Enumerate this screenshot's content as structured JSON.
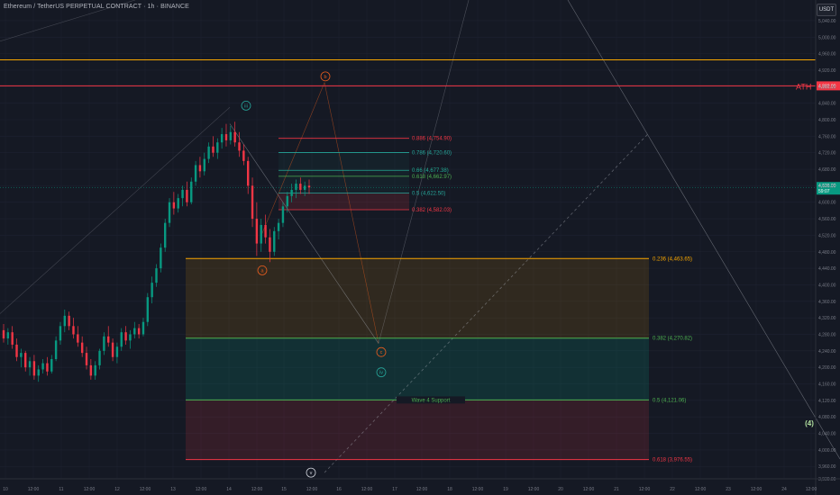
{
  "header": {
    "symbol_title": "Ethereum / TetherUS PERPETUAL CONTRACT · 1h · BINANCE",
    "currency": "USDT"
  },
  "colors": {
    "background": "#151924",
    "grid": "#1f2330",
    "up_candle": "#089981",
    "down_candle": "#f23645",
    "orange_line": "#f7a600",
    "red_line": "#f23645",
    "teal_line": "#22ab94",
    "green_line": "#4caf50",
    "wave_orange": "#e65c1e",
    "wave_teal": "#26a69a",
    "wave_green": "#b2e0a0"
  },
  "chart_data": {
    "type": "candlestick",
    "y_axis": {
      "range": [
        3930,
        5090
      ],
      "ticks": [
        3930,
        3960,
        4000,
        4040,
        4080,
        4120,
        4160,
        4200,
        4240,
        4280,
        4320,
        4360,
        4400,
        4440,
        4480,
        4520,
        4560,
        4600,
        4640,
        4680,
        4720,
        4760,
        4800,
        4840,
        4880,
        4920,
        4960,
        5000,
        5040
      ],
      "tick_labels": [
        "3,930.00",
        "3,960.00",
        "4,000.00",
        "4,040.00",
        "4,080.00",
        "4,120.00",
        "4,160.00",
        "4,200.00",
        "4,240.00",
        "4,280.00",
        "4,320.00",
        "4,360.00",
        "4,400.00",
        "4,440.00",
        "4,480.00",
        "4,520.00",
        "4,560.00",
        "4,600.00",
        "4,640.00",
        "4,680.00",
        "4,720.00",
        "4,760.00",
        "4,800.00",
        "4,840.00",
        "4,880.00",
        "4,920.00",
        "4,960.00",
        "5,000.00",
        "5,040.00"
      ]
    },
    "x_axis": {
      "labels": [
        "10",
        "12:00",
        "11",
        "12:00",
        "12",
        "12:00",
        "13",
        "12:00",
        "14",
        "12:00",
        "15",
        "12:00",
        "16",
        "12:00",
        "17",
        "12:00",
        "18",
        "12:00",
        "19",
        "12:00",
        "20",
        "12:00",
        "21",
        "12:00",
        "22",
        "12:00",
        "23",
        "12:00",
        "24",
        "12:00"
      ]
    },
    "current_price": "4,636.00",
    "countdown": "59:07",
    "horizontal_levels": [
      {
        "label": "ATH",
        "value": 4882,
        "price_tag": "4,882.00",
        "color": "#f23645"
      },
      {
        "label": "",
        "value": 4945,
        "color": "#f7a600"
      }
    ],
    "fib_retracement_small": [
      {
        "label": "0.886 (4,754.90)",
        "value": 4754.9,
        "color": "#f23645"
      },
      {
        "label": "0.786 (4,720.60)",
        "value": 4720.6,
        "color": "#26a69a"
      },
      {
        "label": "0.66 (4,677.38)",
        "value": 4677.38,
        "color": "#22ab94"
      },
      {
        "label": "0.618 (4,662.97)",
        "value": 4662.97,
        "color": "#4caf50"
      },
      {
        "label": "0.5 (4,622.50)",
        "value": 4622.5,
        "color": "#26a69a"
      },
      {
        "label": "0.382 (4,582.03)",
        "value": 4582.03,
        "color": "#f23645"
      }
    ],
    "fib_retracement_large": [
      {
        "label": "0.236 (4,463.65)",
        "value": 4463.65,
        "color": "#f7a600"
      },
      {
        "label": "0.382 (4,270.82)",
        "value": 4270.82,
        "color": "#4caf50"
      },
      {
        "label": "0.5 (4,121.06)",
        "value": 4121.06,
        "color": "#4caf50",
        "mid_label": "Wave 4 Support"
      },
      {
        "label": "0.618 (3,976.55)",
        "value": 3976.55,
        "color": "#f23645"
      }
    ],
    "wave_labels": [
      {
        "text": "iii",
        "color": "#26a69a"
      },
      {
        "text": "b",
        "color": "#e65c1e"
      },
      {
        "text": "a",
        "color": "#e65c1e"
      },
      {
        "text": "c",
        "color": "#e65c1e"
      },
      {
        "text": "iv",
        "color": "#26a69a"
      },
      {
        "text": "v",
        "color": "#d1d4dc"
      },
      {
        "text": "(4)",
        "color": "#b2e0a0"
      }
    ],
    "candles": [
      {
        "o": 4290,
        "h": 4305,
        "l": 4260,
        "c": 4270
      },
      {
        "o": 4270,
        "h": 4295,
        "l": 4255,
        "c": 4285
      },
      {
        "o": 4285,
        "h": 4300,
        "l": 4245,
        "c": 4255
      },
      {
        "o": 4255,
        "h": 4270,
        "l": 4215,
        "c": 4225
      },
      {
        "o": 4225,
        "h": 4245,
        "l": 4200,
        "c": 4235
      },
      {
        "o": 4235,
        "h": 4240,
        "l": 4190,
        "c": 4200
      },
      {
        "o": 4200,
        "h": 4225,
        "l": 4180,
        "c": 4215
      },
      {
        "o": 4215,
        "h": 4230,
        "l": 4170,
        "c": 4180
      },
      {
        "o": 4180,
        "h": 4205,
        "l": 4165,
        "c": 4195
      },
      {
        "o": 4195,
        "h": 4220,
        "l": 4185,
        "c": 4210
      },
      {
        "o": 4210,
        "h": 4225,
        "l": 4180,
        "c": 4190
      },
      {
        "o": 4190,
        "h": 4230,
        "l": 4185,
        "c": 4220
      },
      {
        "o": 4220,
        "h": 4275,
        "l": 4215,
        "c": 4265
      },
      {
        "o": 4265,
        "h": 4310,
        "l": 4255,
        "c": 4300
      },
      {
        "o": 4300,
        "h": 4340,
        "l": 4285,
        "c": 4325
      },
      {
        "o": 4325,
        "h": 4335,
        "l": 4290,
        "c": 4300
      },
      {
        "o": 4300,
        "h": 4320,
        "l": 4270,
        "c": 4280
      },
      {
        "o": 4280,
        "h": 4300,
        "l": 4250,
        "c": 4260
      },
      {
        "o": 4260,
        "h": 4275,
        "l": 4225,
        "c": 4235
      },
      {
        "o": 4235,
        "h": 4250,
        "l": 4195,
        "c": 4205
      },
      {
        "o": 4205,
        "h": 4220,
        "l": 4170,
        "c": 4180
      },
      {
        "o": 4180,
        "h": 4215,
        "l": 4170,
        "c": 4205
      },
      {
        "o": 4205,
        "h": 4245,
        "l": 4195,
        "c": 4240
      },
      {
        "o": 4240,
        "h": 4285,
        "l": 4230,
        "c": 4275
      },
      {
        "o": 4275,
        "h": 4300,
        "l": 4250,
        "c": 4260
      },
      {
        "o": 4260,
        "h": 4270,
        "l": 4215,
        "c": 4225
      },
      {
        "o": 4225,
        "h": 4260,
        "l": 4210,
        "c": 4250
      },
      {
        "o": 4250,
        "h": 4295,
        "l": 4240,
        "c": 4285
      },
      {
        "o": 4285,
        "h": 4300,
        "l": 4255,
        "c": 4265
      },
      {
        "o": 4265,
        "h": 4290,
        "l": 4245,
        "c": 4280
      },
      {
        "o": 4280,
        "h": 4310,
        "l": 4270,
        "c": 4295
      },
      {
        "o": 4295,
        "h": 4305,
        "l": 4270,
        "c": 4280
      },
      {
        "o": 4280,
        "h": 4320,
        "l": 4275,
        "c": 4310
      },
      {
        "o": 4310,
        "h": 4380,
        "l": 4300,
        "c": 4370
      },
      {
        "o": 4370,
        "h": 4420,
        "l": 4355,
        "c": 4405
      },
      {
        "o": 4405,
        "h": 4450,
        "l": 4395,
        "c": 4440
      },
      {
        "o": 4440,
        "h": 4500,
        "l": 4430,
        "c": 4490
      },
      {
        "o": 4490,
        "h": 4560,
        "l": 4480,
        "c": 4550
      },
      {
        "o": 4550,
        "h": 4610,
        "l": 4540,
        "c": 4600
      },
      {
        "o": 4600,
        "h": 4625,
        "l": 4570,
        "c": 4585
      },
      {
        "o": 4585,
        "h": 4620,
        "l": 4575,
        "c": 4610
      },
      {
        "o": 4610,
        "h": 4640,
        "l": 4590,
        "c": 4630
      },
      {
        "o": 4630,
        "h": 4650,
        "l": 4590,
        "c": 4600
      },
      {
        "o": 4600,
        "h": 4660,
        "l": 4595,
        "c": 4650
      },
      {
        "o": 4650,
        "h": 4700,
        "l": 4640,
        "c": 4690
      },
      {
        "o": 4690,
        "h": 4710,
        "l": 4660,
        "c": 4675
      },
      {
        "o": 4675,
        "h": 4720,
        "l": 4665,
        "c": 4705
      },
      {
        "o": 4705,
        "h": 4745,
        "l": 4695,
        "c": 4735
      },
      {
        "o": 4735,
        "h": 4760,
        "l": 4710,
        "c": 4720
      },
      {
        "o": 4720,
        "h": 4755,
        "l": 4705,
        "c": 4745
      },
      {
        "o": 4745,
        "h": 4780,
        "l": 4730,
        "c": 4765
      },
      {
        "o": 4765,
        "h": 4790,
        "l": 4735,
        "c": 4750
      },
      {
        "o": 4750,
        "h": 4785,
        "l": 4740,
        "c": 4770
      },
      {
        "o": 4770,
        "h": 4795,
        "l": 4735,
        "c": 4745
      },
      {
        "o": 4745,
        "h": 4770,
        "l": 4710,
        "c": 4725
      },
      {
        "o": 4725,
        "h": 4740,
        "l": 4690,
        "c": 4700
      },
      {
        "o": 4700,
        "h": 4710,
        "l": 4620,
        "c": 4640
      },
      {
        "o": 4640,
        "h": 4660,
        "l": 4540,
        "c": 4560
      },
      {
        "o": 4560,
        "h": 4600,
        "l": 4470,
        "c": 4500
      },
      {
        "o": 4500,
        "h": 4560,
        "l": 4480,
        "c": 4545
      },
      {
        "o": 4545,
        "h": 4570,
        "l": 4500,
        "c": 4515
      },
      {
        "o": 4515,
        "h": 4535,
        "l": 4455,
        "c": 4480
      },
      {
        "o": 4480,
        "h": 4540,
        "l": 4470,
        "c": 4530
      },
      {
        "o": 4530,
        "h": 4560,
        "l": 4510,
        "c": 4550
      },
      {
        "o": 4550,
        "h": 4600,
        "l": 4540,
        "c": 4590
      },
      {
        "o": 4590,
        "h": 4625,
        "l": 4575,
        "c": 4615
      },
      {
        "o": 4615,
        "h": 4645,
        "l": 4600,
        "c": 4630
      },
      {
        "o": 4630,
        "h": 4655,
        "l": 4610,
        "c": 4645
      },
      {
        "o": 4645,
        "h": 4660,
        "l": 4620,
        "c": 4630
      },
      {
        "o": 4630,
        "h": 4650,
        "l": 4615,
        "c": 4640
      },
      {
        "o": 4640,
        "h": 4655,
        "l": 4620,
        "c": 4636
      }
    ]
  }
}
